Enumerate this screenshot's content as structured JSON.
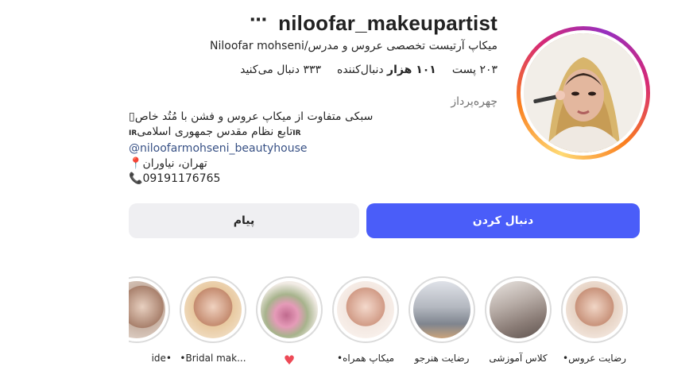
{
  "profile": {
    "username": "niloofar_makeupartist",
    "more_icon": "⋯",
    "fullname_line": "میکاپ آرتیست تخصصی عروس و مدرس/Niloofar mohseni",
    "stats": {
      "posts": "۲۰۳ پست",
      "followers_count": "۱۰۱ هزار",
      "followers_label": "دنبال‌کننده",
      "following": "۳۳۳ دنبال می‌کنید"
    },
    "category": "چهره‌پرداز",
    "bio_lines": [
      "سبکی متفاوت از میکاپ عروس و فشن با مُتُد خاص",
      "تابع نظام مقدس جمهوری اسلامی",
      "@niloofarmohseni_beautyhouse",
      "تهران، نیاوران",
      "09191176765"
    ],
    "bio_icons": {
      "line1": "▯",
      "line2_flag": "IR",
      "line2_flag_after": "IR",
      "line4": "📍",
      "line5": "📞"
    }
  },
  "actions": {
    "follow_label": "دنبال کردن",
    "message_label": "پیام"
  },
  "highlights": [
    {
      "label": "•رضایت عروس",
      "palette": [
        "#f1d6c6",
        "#c8927a"
      ]
    },
    {
      "label": "کلاس آموزشی",
      "palette": [
        "#e9e4e0",
        "#8a7c76"
      ]
    },
    {
      "label": "رضایت هنرجو",
      "palette": [
        "#dfe2e8",
        "#7f858f"
      ]
    },
    {
      "label": "•میکاپ همراه",
      "palette": [
        "#f4d9cc",
        "#d19b86"
      ]
    },
    {
      "label": "♥",
      "palette": [
        "#f2ece6",
        "#c06a8e"
      ]
    },
    {
      "label": "•Bridal mak...",
      "palette": [
        "#f0d2c0",
        "#c48b6f"
      ]
    },
    {
      "label": "ide•",
      "palette": [
        "#e8d0c0",
        "#a8806c"
      ]
    }
  ],
  "colors": {
    "follow_button": "#4a5df9",
    "message_button": "#efeff2",
    "link": "#385185",
    "heart": "#ed4956"
  }
}
